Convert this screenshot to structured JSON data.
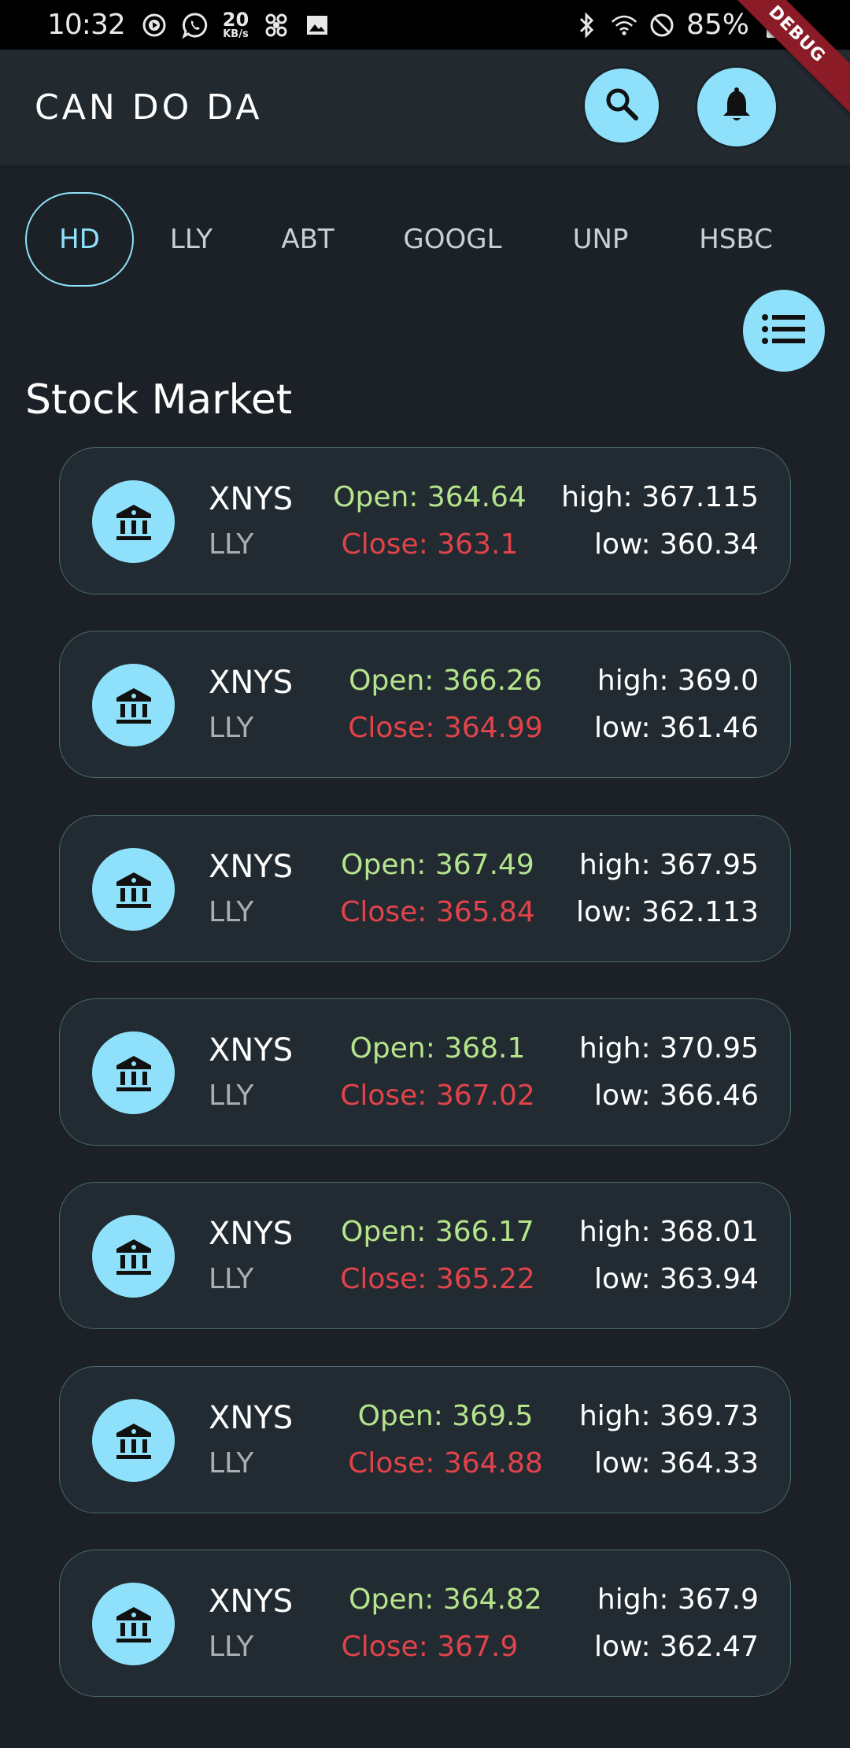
{
  "status_bar": {
    "time": "10:32",
    "net_speed_value": "20",
    "net_speed_unit": "KB/s",
    "battery": "85%",
    "icons_left": [
      "play-circle-icon",
      "whatsapp-icon",
      "net-speed-icon",
      "fan-icon",
      "image-icon"
    ],
    "icons_right": [
      "bluetooth-icon",
      "wifi-icon",
      "do-not-disturb-icon",
      "battery-icon"
    ]
  },
  "debug_banner": "DEBUG",
  "app_bar": {
    "title": "CAN DO DA",
    "search_icon": "search-icon",
    "bell_icon": "bell-icon"
  },
  "tabs": [
    {
      "label": "HD",
      "active": true
    },
    {
      "label": "LLY",
      "active": false
    },
    {
      "label": "ABT",
      "active": false
    },
    {
      "label": "GOOGL",
      "active": false
    },
    {
      "label": "UNP",
      "active": false
    },
    {
      "label": "HSBC",
      "active": false
    }
  ],
  "list_button_icon": "list-icon",
  "section_title": "Stock Market",
  "colors": {
    "background": "#1b2126",
    "accent": "#8fe1fb",
    "open": "#b5e48c",
    "close": "#e2434a",
    "card_border": "#4b6a73"
  },
  "cards": [
    {
      "exchange": "XNYS",
      "symbol": "LLY",
      "open": "Open: 364.64",
      "close": "Close: 363.1",
      "high": "high: 367.115",
      "low": "low: 360.34"
    },
    {
      "exchange": "XNYS",
      "symbol": "LLY",
      "open": "Open: 366.26",
      "close": "Close: 364.99",
      "high": "high: 369.0",
      "low": "low: 361.46"
    },
    {
      "exchange": "XNYS",
      "symbol": "LLY",
      "open": "Open: 367.49",
      "close": "Close: 365.84",
      "high": "high: 367.95",
      "low": "low: 362.113"
    },
    {
      "exchange": "XNYS",
      "symbol": "LLY",
      "open": "Open: 368.1",
      "close": "Close: 367.02",
      "high": "high: 370.95",
      "low": "low: 366.46"
    },
    {
      "exchange": "XNYS",
      "symbol": "LLY",
      "open": "Open: 366.17",
      "close": "Close: 365.22",
      "high": "high: 368.01",
      "low": "low: 363.94"
    },
    {
      "exchange": "XNYS",
      "symbol": "LLY",
      "open": "Open: 369.5",
      "close": "Close: 364.88",
      "high": "high: 369.73",
      "low": "low: 364.33"
    },
    {
      "exchange": "XNYS",
      "symbol": "LLY",
      "open": "Open: 364.82",
      "close": "Close: 367.9",
      "high": "high: 367.9",
      "low": "low: 362.47"
    }
  ]
}
